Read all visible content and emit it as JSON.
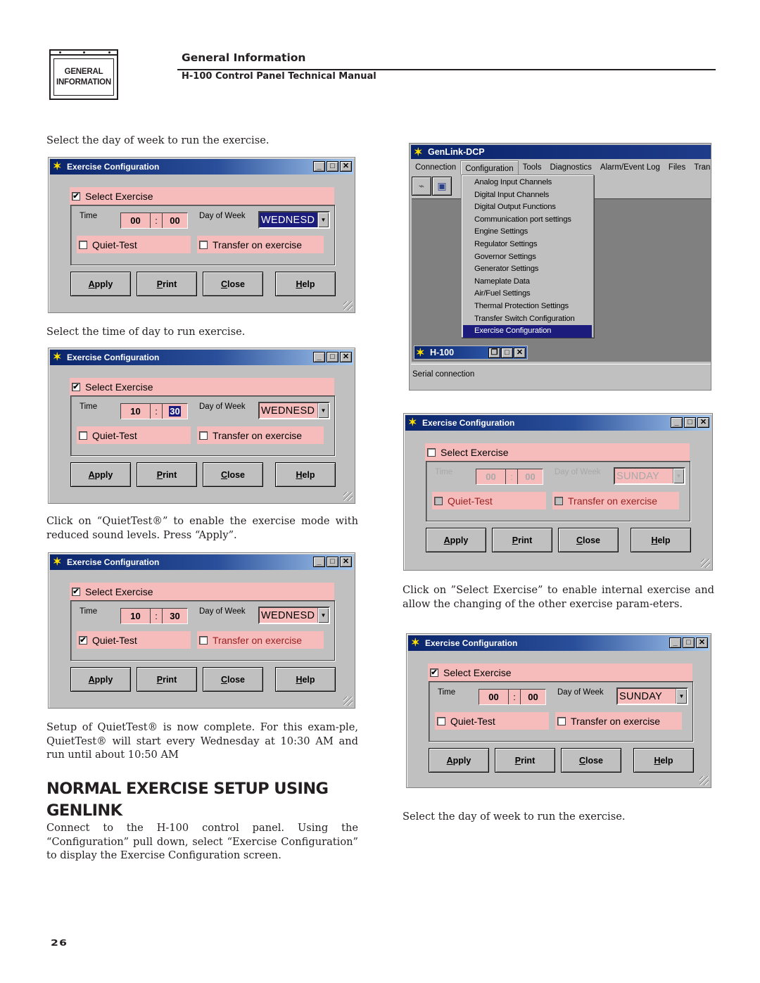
{
  "header": {
    "badge_line1": "GENERAL",
    "badge_line2": "INFORMATION",
    "section_title": "General Information",
    "manual_title": "H-100 Control Panel Technical Manual"
  },
  "left_column": {
    "caption1": "Select the day of week to run the exercise.",
    "caption2": "Select the time of day to run exercise.",
    "caption3": "Click on “QuietTest®” to enable the exercise mode with reduced sound levels. Press “Apply”.",
    "caption4": "Setup of QuietTest® is now complete. For this exam-ple, QuietTest® will start every Wednesday at 10:30 AM and run until about 10:50 AM",
    "heading": "NORMAL EXERCISE SETUP USING GENLINK",
    "body": "Connect to the H-100 control panel. Using the “Configuration” pull down, select “Exercise Configuration” to display the Exercise Configuration screen."
  },
  "right_column": {
    "caption1": "Click on ”Select Exercise” to enable internal exercise and allow the changing of the other exercise param-eters.",
    "caption2": "Select the day of week to run the exercise."
  },
  "page_number": "26",
  "dialog_labels": {
    "title": "Exercise Configuration",
    "select_exercise": "Select Exercise",
    "time_label": "Time",
    "colon": ":",
    "dow_label": "Day of Week",
    "quiet_test": "Quiet-Test",
    "transfer": "Transfer on exercise",
    "apply": "Apply",
    "print": "Print",
    "close": "Close",
    "help": "Help",
    "minimize_glyph": "_",
    "maximize_glyph": "□",
    "close_glyph": "✕",
    "dropdown_glyph": "▼",
    "check_glyph": "✔"
  },
  "dialogs": [
    {
      "id": "d1",
      "select_exercise": true,
      "hour": "00",
      "minute": "00",
      "day": "WEDNESD",
      "day_highlighted": true,
      "minute_highlighted": false,
      "quiet_test": false,
      "transfer": false,
      "disabled": false
    },
    {
      "id": "d2",
      "select_exercise": true,
      "hour": "10",
      "minute": "30",
      "day": "WEDNESD",
      "day_highlighted": false,
      "minute_highlighted": true,
      "quiet_test": false,
      "transfer": false,
      "disabled": false
    },
    {
      "id": "d3",
      "select_exercise": true,
      "hour": "10",
      "minute": "30",
      "day": "WEDNESD",
      "day_highlighted": false,
      "minute_highlighted": false,
      "quiet_test": true,
      "transfer": false,
      "transfer_red": true,
      "disabled": false
    },
    {
      "id": "d4",
      "select_exercise": false,
      "hour": "00",
      "minute": "00",
      "day": "SUNDAY",
      "day_highlighted": false,
      "minute_highlighted": false,
      "quiet_test": false,
      "transfer": false,
      "disabled": true
    },
    {
      "id": "d5",
      "select_exercise": true,
      "hour": "00",
      "minute": "00",
      "day": "SUNDAY",
      "day_highlighted": false,
      "minute_highlighted": false,
      "quiet_test": false,
      "transfer": false,
      "disabled": false
    }
  ],
  "genlink": {
    "title": "GenLink-DCP",
    "menus": [
      "Connection",
      "Configuration",
      "Tools",
      "Diagnostics",
      "Alarm/Event Log",
      "Files",
      "Transfe"
    ],
    "open_menu": "Configuration",
    "config_items": [
      "Analog Input Channels",
      "Digital Input Channels",
      "Digital Output Functions",
      "Communication port settings",
      "Engine Settings",
      "Regulator  Settings",
      "Governor Settings",
      "Generator Settings",
      "Nameplate Data",
      "Air/Fuel Settings",
      "Thermal Protection Settings",
      "Transfer Switch Configuration",
      "Exercise Configuration"
    ],
    "selected_item": "Exercise Configuration",
    "child_window_title": "H-100",
    "status": "Serial connection"
  }
}
